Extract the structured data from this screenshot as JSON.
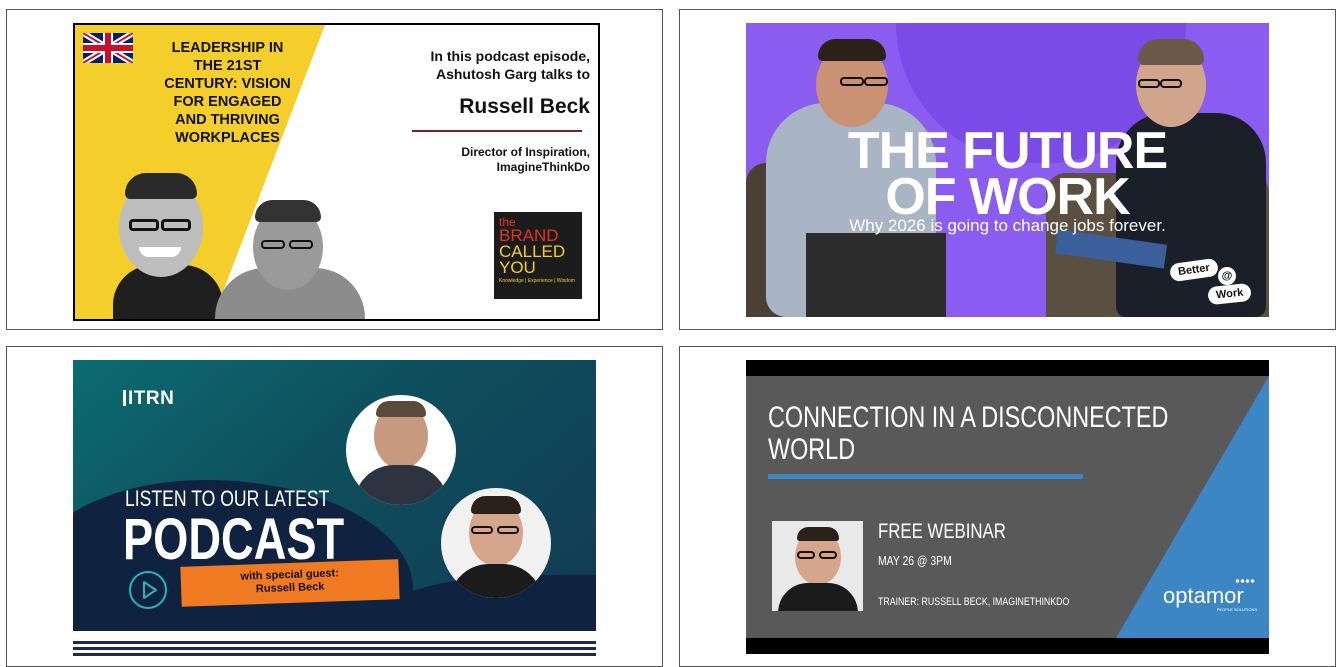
{
  "cards": [
    {
      "title_lines": [
        "LEADERSHIP IN",
        "THE 21ST",
        "CENTURY: VISION",
        "FOR ENGAGED",
        "AND THRIVING",
        "WORKPLACES"
      ],
      "intro_lines": [
        "In this podcast episode,",
        "Ashutosh Garg talks to"
      ],
      "guest_name": "Russell Beck",
      "role_lines": [
        "Director of Inspiration,",
        "ImagineThinkDo"
      ],
      "logo_lines": [
        "the",
        "BRAND",
        "CALLED",
        "YOU"
      ],
      "logo_tagline": "Knowledge | Experience | Wisdom"
    },
    {
      "headline_line1": "THE FUTURE",
      "headline_line2": "OF WORK",
      "subtitle": "Why 2026 is going to change jobs forever.",
      "badge_top": "Better",
      "badge_at": "@",
      "badge_bottom": "Work"
    },
    {
      "brand": "ITRN",
      "kicker": "LISTEN TO OUR LATEST",
      "headline": "PODCAST",
      "guest_label": "with special guest:",
      "guest_name": "Russell Beck"
    },
    {
      "title_lines": [
        "CONNECTION IN A DISCONNECTED",
        "WORLD"
      ],
      "event_title": "FREE WEBINAR",
      "event_date": "MAY 26 @ 3PM",
      "trainer": "TRAINER: RUSSELL BECK, IMAGINETHINKDO",
      "logo_text": "optamor",
      "logo_tagline": "PEOPLE SOLUTIONS"
    }
  ]
}
